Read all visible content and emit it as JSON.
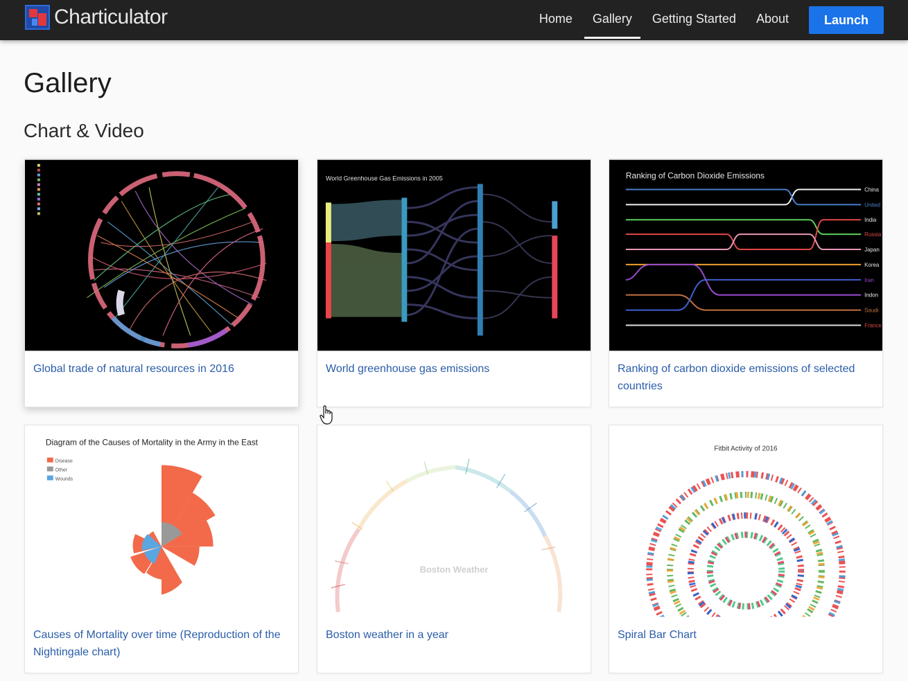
{
  "app": {
    "name": "Charticulator"
  },
  "nav": {
    "items": [
      "Home",
      "Gallery",
      "Getting Started",
      "About"
    ],
    "active": "Gallery",
    "launch_label": "Launch"
  },
  "page": {
    "title": "Gallery",
    "section": "Chart & Video"
  },
  "cards": [
    {
      "caption": "Global trade of natural resources in 2016",
      "thumb": "chord-diagram"
    },
    {
      "caption": "World greenhouse gas emissions",
      "thumb": "sankey-diagram",
      "thumb_title": "World Greenhouse Gas Emissions in 2005"
    },
    {
      "caption": "Ranking of carbon dioxide emissions of selected countries",
      "thumb": "bump-chart",
      "thumb_title": "Ranking of Carbon Dioxide Emissions",
      "thumb_labels": [
        "China",
        "United",
        "India",
        "Russia",
        "Japan",
        "Korea",
        "Iran",
        "Indon",
        "Saudi",
        "France"
      ]
    },
    {
      "caption": "Causes of Mortality over time (Reproduction of the Nightingale chart)",
      "thumb": "nightingale-rose",
      "thumb_title": "Diagram of the Causes of Mortality in the Army in the East",
      "legend": [
        "Disease",
        "Other",
        "Wounds"
      ]
    },
    {
      "caption": "Boston weather in a year",
      "thumb": "radial-weather",
      "thumb_title": "Boston Weather"
    },
    {
      "caption": "Spiral Bar Chart",
      "thumb": "spiral-bar",
      "thumb_title": "Fitbit Activity of 2016"
    }
  ],
  "colors": {
    "navbar": "#222222",
    "accent": "#1a73e8",
    "link": "#2a5da8"
  }
}
